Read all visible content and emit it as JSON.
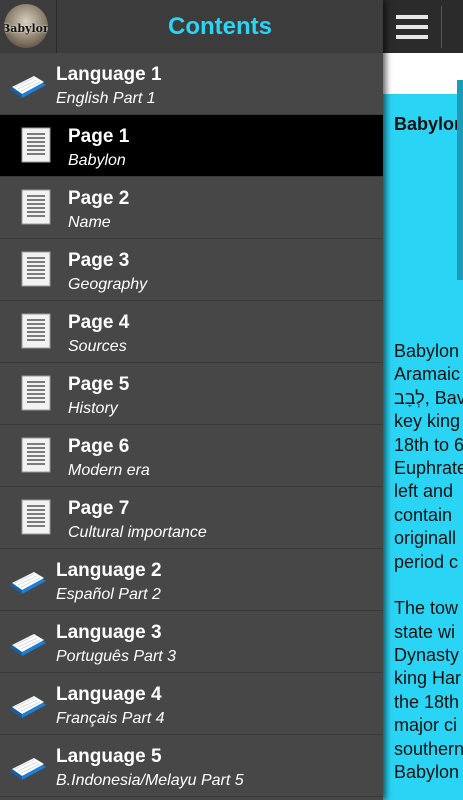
{
  "header": {
    "title": "Contents",
    "avatar_text": "Babylon"
  },
  "article": {
    "title": "Babylon",
    "text_fragments": [
      "Babylon",
      "Aramaic",
      "לְבָב, Bav",
      "key king",
      "18th to 6",
      "Euphrate",
      "left and",
      "contain",
      "originall",
      "period c",
      "",
      "The tow",
      "state wi",
      "Dynasty",
      "king Har",
      "the 18th",
      "major ci",
      "southern",
      "Babylon"
    ]
  },
  "contents": [
    {
      "kind": "language",
      "title": "Language 1",
      "subtitle": "English Part 1",
      "active": false
    },
    {
      "kind": "page",
      "title": "Page 1",
      "subtitle": "Babylon",
      "active": true
    },
    {
      "kind": "page",
      "title": "Page 2",
      "subtitle": "Name",
      "active": false
    },
    {
      "kind": "page",
      "title": "Page 3",
      "subtitle": "Geography",
      "active": false
    },
    {
      "kind": "page",
      "title": "Page 4",
      "subtitle": "Sources",
      "active": false
    },
    {
      "kind": "page",
      "title": "Page 5",
      "subtitle": "History",
      "active": false
    },
    {
      "kind": "page",
      "title": "Page 6",
      "subtitle": "Modern era",
      "active": false
    },
    {
      "kind": "page",
      "title": "Page 7",
      "subtitle": "Cultural importance",
      "active": false
    },
    {
      "kind": "language",
      "title": "Language 2",
      "subtitle": "Español Part 2",
      "active": false
    },
    {
      "kind": "language",
      "title": "Language 3",
      "subtitle": "Português Part 3",
      "active": false
    },
    {
      "kind": "language",
      "title": "Language 4",
      "subtitle": "Français Part 4",
      "active": false
    },
    {
      "kind": "language",
      "title": "Language 5",
      "subtitle": "B.Indonesia/Melayu Part 5",
      "active": false
    }
  ],
  "icons": {
    "language": "book-icon",
    "page": "document-icon",
    "menu": "hamburger-menu-icon"
  },
  "colors": {
    "accent": "#2ad4f4",
    "drawer_bg": "#474747",
    "active_row": "#000000",
    "header_bg": "#3c3c3c"
  }
}
